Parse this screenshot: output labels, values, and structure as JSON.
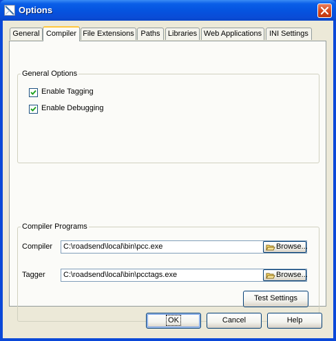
{
  "window": {
    "title": "Options",
    "icons": {
      "app": "options-app-icon",
      "close": "close-icon"
    }
  },
  "tabs": [
    {
      "label": "General",
      "active": false
    },
    {
      "label": "Compiler",
      "active": true
    },
    {
      "label": "File Extensions",
      "active": false
    },
    {
      "label": "Paths",
      "active": false
    },
    {
      "label": "Libraries",
      "active": false
    },
    {
      "label": "Web Applications",
      "active": false
    },
    {
      "label": "INI Settings",
      "active": false
    }
  ],
  "general_options": {
    "title": "General Options",
    "enable_tagging": {
      "label": "Enable Tagging",
      "checked": true
    },
    "enable_debugging": {
      "label": "Enable Debugging",
      "checked": true
    }
  },
  "compiler_programs": {
    "title": "Compiler Programs",
    "compiler": {
      "label": "Compiler",
      "value": "C:\\roadsend\\local\\bin\\pcc.exe",
      "browse_label": "Browse..."
    },
    "tagger": {
      "label": "Tagger",
      "value": "C:\\roadsend\\local\\bin\\pcctags.exe",
      "browse_label": "Browse..."
    },
    "test_settings_label": "Test Settings"
  },
  "buttons": {
    "ok": "OK",
    "cancel": "Cancel",
    "help": "Help"
  },
  "colors": {
    "titlebar": "#0554e0",
    "dialog_bg": "#ece9d8",
    "active_tab_accent": "#ffc73c",
    "close_button": "#d44618"
  }
}
